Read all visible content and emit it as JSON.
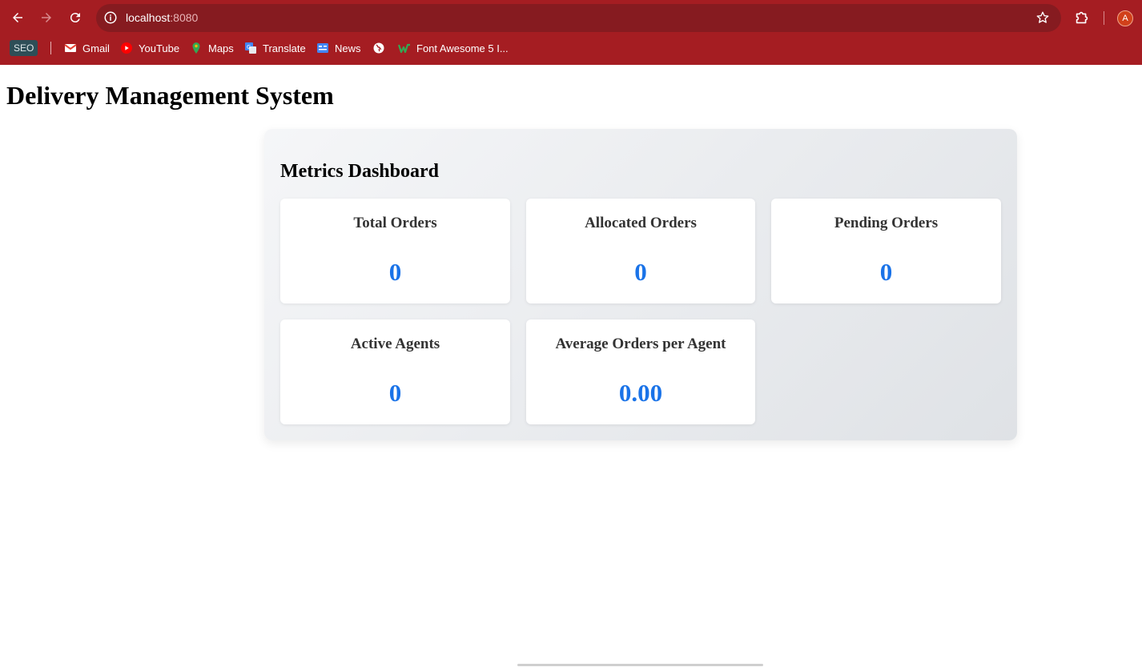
{
  "browser": {
    "url_host": "localhost",
    "url_port": ":8080",
    "profile_initial": "A",
    "bookmarks": [
      {
        "label": "SEO",
        "icon": "seo-badge"
      },
      {
        "label": "Gmail",
        "icon": "gmail-icon"
      },
      {
        "label": "YouTube",
        "icon": "youtube-icon"
      },
      {
        "label": "Maps",
        "icon": "maps-icon"
      },
      {
        "label": "Translate",
        "icon": "translate-icon"
      },
      {
        "label": "News",
        "icon": "news-icon"
      },
      {
        "label": "",
        "icon": "globe-icon"
      },
      {
        "label": "Font Awesome 5 I...",
        "icon": "font-awesome-icon"
      }
    ],
    "colors": {
      "chrome": "#a51d22",
      "omnibox": "#861b20"
    }
  },
  "page": {
    "title": "Delivery Management System"
  },
  "dashboard": {
    "title": "Metrics Dashboard",
    "value_color": "#1a73e8",
    "metrics": [
      {
        "label": "Total Orders",
        "value": "0"
      },
      {
        "label": "Allocated Orders",
        "value": "0"
      },
      {
        "label": "Pending Orders",
        "value": "0"
      },
      {
        "label": "Active Agents",
        "value": "0"
      },
      {
        "label": "Average Orders per Agent",
        "value": "0.00"
      }
    ]
  }
}
